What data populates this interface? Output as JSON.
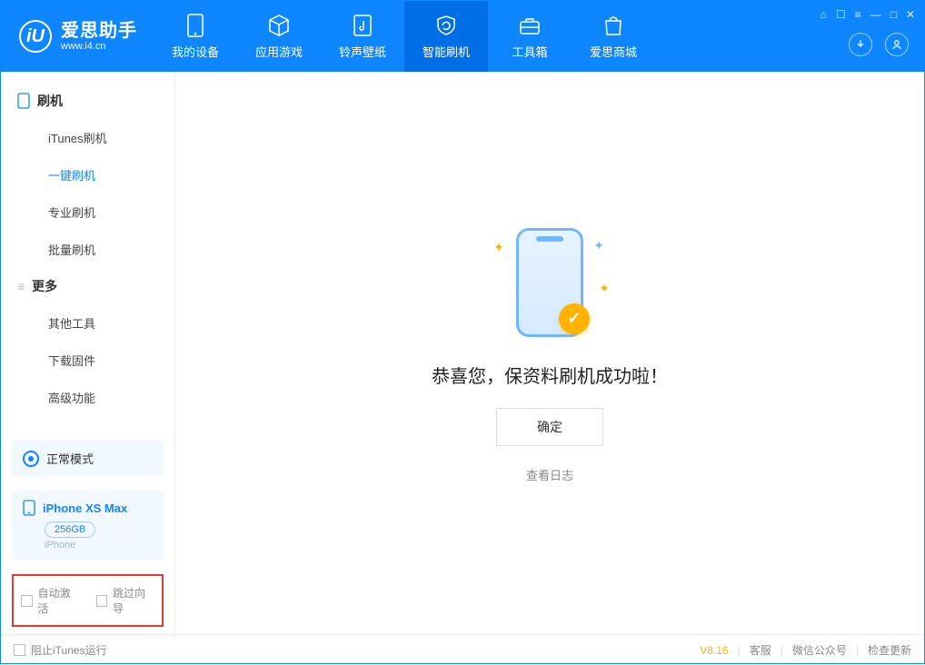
{
  "brand": {
    "title": "爱思助手",
    "subtitle": "www.i4.cn",
    "logo_letter": "iU"
  },
  "nav": {
    "items": [
      {
        "label": "我的设备"
      },
      {
        "label": "应用游戏"
      },
      {
        "label": "铃声壁纸"
      },
      {
        "label": "智能刷机"
      },
      {
        "label": "工具箱"
      },
      {
        "label": "爱思商城"
      }
    ]
  },
  "sidebar": {
    "group1_title": "刷机",
    "group1_items": [
      {
        "label": "iTunes刷机"
      },
      {
        "label": "一键刷机"
      },
      {
        "label": "专业刷机"
      },
      {
        "label": "批量刷机"
      }
    ],
    "group2_title": "更多",
    "group2_items": [
      {
        "label": "其他工具"
      },
      {
        "label": "下载固件"
      },
      {
        "label": "高级功能"
      }
    ]
  },
  "mode": {
    "label": "正常模式"
  },
  "device": {
    "name": "iPhone XS Max",
    "capacity": "256GB",
    "type": "iPhone"
  },
  "options": {
    "auto_activate": "自动激活",
    "skip_guide": "跳过向导"
  },
  "main": {
    "success_title": "恭喜您，保资料刷机成功啦！",
    "ok_button": "确定",
    "view_log": "查看日志"
  },
  "footer": {
    "block_itunes": "阻止iTunes运行",
    "version": "V8.16",
    "links": [
      "客服",
      "微信公众号",
      "检查更新"
    ]
  }
}
